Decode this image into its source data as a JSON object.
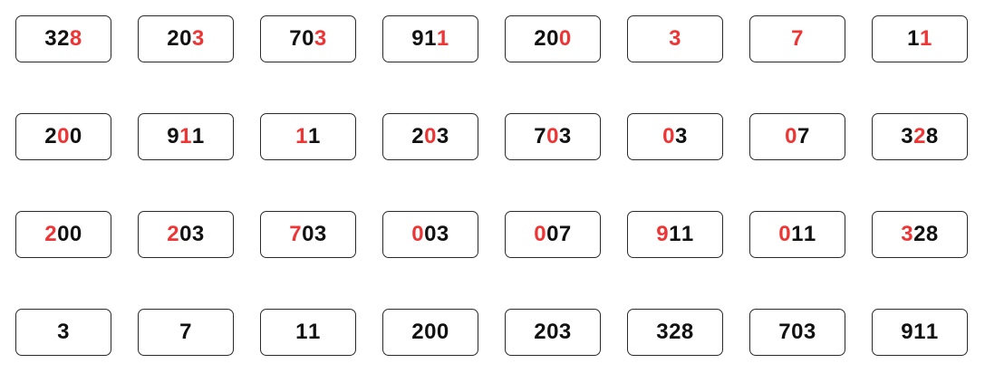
{
  "colors": {
    "normal": "#111111",
    "highlight": "#ee3535"
  },
  "rows": [
    {
      "cards": [
        {
          "digits": [
            {
              "d": "3",
              "hl": false
            },
            {
              "d": "2",
              "hl": false
            },
            {
              "d": "8",
              "hl": true
            }
          ]
        },
        {
          "digits": [
            {
              "d": "2",
              "hl": false
            },
            {
              "d": "0",
              "hl": false
            },
            {
              "d": "3",
              "hl": true
            }
          ]
        },
        {
          "digits": [
            {
              "d": "7",
              "hl": false
            },
            {
              "d": "0",
              "hl": false
            },
            {
              "d": "3",
              "hl": true
            }
          ]
        },
        {
          "digits": [
            {
              "d": "9",
              "hl": false
            },
            {
              "d": "1",
              "hl": false
            },
            {
              "d": "1",
              "hl": true
            }
          ]
        },
        {
          "digits": [
            {
              "d": "2",
              "hl": false
            },
            {
              "d": "0",
              "hl": false
            },
            {
              "d": "0",
              "hl": true
            }
          ]
        },
        {
          "digits": [
            {
              "d": "3",
              "hl": true
            }
          ]
        },
        {
          "digits": [
            {
              "d": "7",
              "hl": true
            }
          ]
        },
        {
          "digits": [
            {
              "d": "1",
              "hl": false
            },
            {
              "d": "1",
              "hl": true
            }
          ]
        }
      ]
    },
    {
      "cards": [
        {
          "digits": [
            {
              "d": "2",
              "hl": false
            },
            {
              "d": "0",
              "hl": true
            },
            {
              "d": "0",
              "hl": false
            }
          ]
        },
        {
          "digits": [
            {
              "d": "9",
              "hl": false
            },
            {
              "d": "1",
              "hl": true
            },
            {
              "d": "1",
              "hl": false
            }
          ]
        },
        {
          "digits": [
            {
              "d": "1",
              "hl": true
            },
            {
              "d": "1",
              "hl": false
            }
          ]
        },
        {
          "digits": [
            {
              "d": "2",
              "hl": false
            },
            {
              "d": "0",
              "hl": true
            },
            {
              "d": "3",
              "hl": false
            }
          ]
        },
        {
          "digits": [
            {
              "d": "7",
              "hl": false
            },
            {
              "d": "0",
              "hl": true
            },
            {
              "d": "3",
              "hl": false
            }
          ]
        },
        {
          "digits": [
            {
              "d": "0",
              "hl": true
            },
            {
              "d": "3",
              "hl": false
            }
          ]
        },
        {
          "digits": [
            {
              "d": "0",
              "hl": true
            },
            {
              "d": "7",
              "hl": false
            }
          ]
        },
        {
          "digits": [
            {
              "d": "3",
              "hl": false
            },
            {
              "d": "2",
              "hl": true
            },
            {
              "d": "8",
              "hl": false
            }
          ]
        }
      ]
    },
    {
      "cards": [
        {
          "digits": [
            {
              "d": "2",
              "hl": true
            },
            {
              "d": "0",
              "hl": false
            },
            {
              "d": "0",
              "hl": false
            }
          ]
        },
        {
          "digits": [
            {
              "d": "2",
              "hl": true
            },
            {
              "d": "0",
              "hl": false
            },
            {
              "d": "3",
              "hl": false
            }
          ]
        },
        {
          "digits": [
            {
              "d": "7",
              "hl": true
            },
            {
              "d": "0",
              "hl": false
            },
            {
              "d": "3",
              "hl": false
            }
          ]
        },
        {
          "digits": [
            {
              "d": "0",
              "hl": true
            },
            {
              "d": "0",
              "hl": false
            },
            {
              "d": "3",
              "hl": false
            }
          ]
        },
        {
          "digits": [
            {
              "d": "0",
              "hl": true
            },
            {
              "d": "0",
              "hl": false
            },
            {
              "d": "7",
              "hl": false
            }
          ]
        },
        {
          "digits": [
            {
              "d": "9",
              "hl": true
            },
            {
              "d": "1",
              "hl": false
            },
            {
              "d": "1",
              "hl": false
            }
          ]
        },
        {
          "digits": [
            {
              "d": "0",
              "hl": true
            },
            {
              "d": "1",
              "hl": false
            },
            {
              "d": "1",
              "hl": false
            }
          ]
        },
        {
          "digits": [
            {
              "d": "3",
              "hl": true
            },
            {
              "d": "2",
              "hl": false
            },
            {
              "d": "8",
              "hl": false
            }
          ]
        }
      ]
    },
    {
      "cards": [
        {
          "digits": [
            {
              "d": "3",
              "hl": false
            }
          ]
        },
        {
          "digits": [
            {
              "d": "7",
              "hl": false
            }
          ]
        },
        {
          "digits": [
            {
              "d": "1",
              "hl": false
            },
            {
              "d": "1",
              "hl": false
            }
          ]
        },
        {
          "digits": [
            {
              "d": "2",
              "hl": false
            },
            {
              "d": "0",
              "hl": false
            },
            {
              "d": "0",
              "hl": false
            }
          ]
        },
        {
          "digits": [
            {
              "d": "2",
              "hl": false
            },
            {
              "d": "0",
              "hl": false
            },
            {
              "d": "3",
              "hl": false
            }
          ]
        },
        {
          "digits": [
            {
              "d": "3",
              "hl": false
            },
            {
              "d": "2",
              "hl": false
            },
            {
              "d": "8",
              "hl": false
            }
          ]
        },
        {
          "digits": [
            {
              "d": "7",
              "hl": false
            },
            {
              "d": "0",
              "hl": false
            },
            {
              "d": "3",
              "hl": false
            }
          ]
        },
        {
          "digits": [
            {
              "d": "9",
              "hl": false
            },
            {
              "d": "1",
              "hl": false
            },
            {
              "d": "1",
              "hl": false
            }
          ]
        }
      ]
    }
  ]
}
